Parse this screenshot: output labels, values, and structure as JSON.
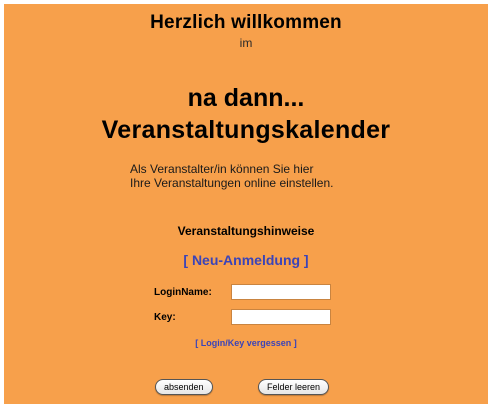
{
  "header": {
    "welcome": "Herzlich willkommen",
    "im": "im",
    "title_line1": "na dann...",
    "title_line2": "Veranstaltungskalender"
  },
  "intro": {
    "line1": "Als Veranstalter/in können Sie hier",
    "line2": "Ihre Veranstaltungen online einstellen."
  },
  "links": {
    "hints": "Veranstaltungshinweise",
    "register": "[ Neu-Anmeldung ]",
    "forgot": "[ Login/Key vergessen ]"
  },
  "form": {
    "login_label": "LoginName:",
    "login_value": "",
    "key_label": "Key:",
    "key_value": "",
    "submit_label": "absenden",
    "reset_label": "Felder leeren"
  },
  "colors": {
    "background": "#f7a04b",
    "link": "#3b44b8"
  }
}
